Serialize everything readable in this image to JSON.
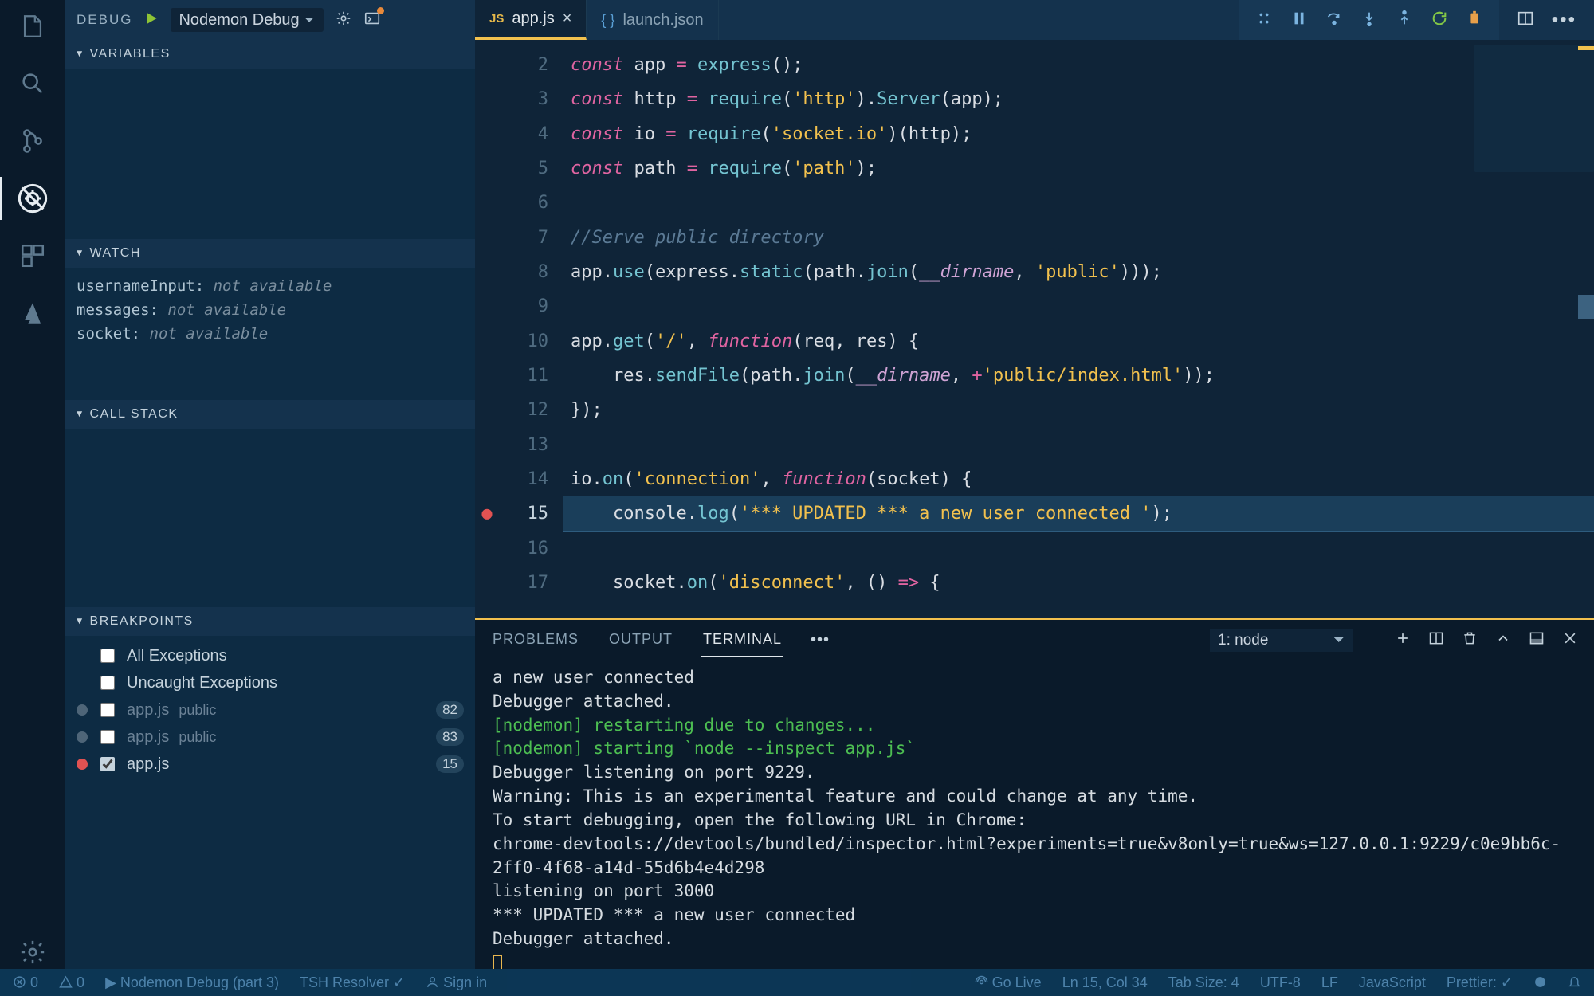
{
  "debug_toolbar": {
    "label": "DEBUG",
    "config": "Nodemon Debug"
  },
  "sections": {
    "variables": "VARIABLES",
    "watch": "WATCH",
    "call_stack": "CALL STACK",
    "breakpoints": "BREAKPOINTS"
  },
  "watch": [
    {
      "name": "usernameInput:",
      "state": "not available"
    },
    {
      "name": "messages:",
      "state": "not available"
    },
    {
      "name": "socket:",
      "state": "not available"
    }
  ],
  "breakpoints": {
    "all": "All Exceptions",
    "uncaught": "Uncaught Exceptions",
    "items": [
      {
        "file": "app.js",
        "path": "public",
        "line": "82",
        "active": false
      },
      {
        "file": "app.js",
        "path": "public",
        "line": "83",
        "active": false
      },
      {
        "file": "app.js",
        "path": "",
        "line": "15",
        "active": true
      }
    ]
  },
  "tabs": [
    {
      "label": "app.js",
      "type": "js",
      "active": true,
      "dirty": false
    },
    {
      "label": "launch.json",
      "type": "json",
      "active": false
    }
  ],
  "code": {
    "start": 2,
    "bp_line": 15,
    "hl_line": 15,
    "lines": [
      "<span class='kw'>const</span> <span class='vn'>app</span> <span class='op'>=</span> <span class='fnc'>express</span><span class='pn'>();</span>",
      "<span class='kw'>const</span> <span class='vn'>http</span> <span class='op'>=</span> <span class='fnc'>require</span><span class='pn'>(</span><span class='str'>'http'</span><span class='pn'>).</span><span class='fnc'>Server</span><span class='pn'>(</span><span class='vn'>app</span><span class='pn'>);</span>",
      "<span class='kw'>const</span> <span class='vn'>io</span> <span class='op'>=</span> <span class='fnc'>require</span><span class='pn'>(</span><span class='str'>'socket.io'</span><span class='pn'>)(</span><span class='vn'>http</span><span class='pn'>);</span>",
      "<span class='kw'>const</span> <span class='vn'>path</span> <span class='op'>=</span> <span class='fnc'>require</span><span class='pn'>(</span><span class='str'>'path'</span><span class='pn'>);</span>",
      "",
      "<span class='cm'>//Serve public directory</span>",
      "<span class='vn'>app</span><span class='pn'>.</span><span class='fnc'>use</span><span class='pn'>(</span><span class='vn'>express</span><span class='pn'>.</span><span class='fnc'>static</span><span class='pn'>(</span><span class='vn'>path</span><span class='pn'>.</span><span class='fnc'>join</span><span class='pn'>(</span><span class='dir'>__dirname</span><span class='pn'>, </span><span class='str'>'public'</span><span class='pn'>)));</span>",
      "",
      "<span class='vn'>app</span><span class='pn'>.</span><span class='fnc'>get</span><span class='pn'>(</span><span class='str'>'/'</span><span class='pn'>, </span><span class='kw2'>function</span><span class='pn'>(</span><span class='vn'>req</span><span class='pn'>, </span><span class='vn'>res</span><span class='pn'>) {</span>",
      "    <span class='vn'>res</span><span class='pn'>.</span><span class='fnc'>sendFile</span><span class='pn'>(</span><span class='vn'>path</span><span class='pn'>.</span><span class='fnc'>join</span><span class='pn'>(</span><span class='dir'>__dirname</span><span class='pn'>, </span><span class='op'>+</span><span class='str'>'public/index.html'</span><span class='pn'>));</span>",
      "<span class='pn'>});</span>",
      "",
      "<span class='vn'>io</span><span class='pn'>.</span><span class='fnc'>on</span><span class='pn'>(</span><span class='str'>'connection'</span><span class='pn'>, </span><span class='kw2'>function</span><span class='pn'>(</span><span class='vn'>socket</span><span class='pn'>) {</span>",
      "    <span class='vn'>console</span><span class='pn'>.</span><span class='fnc'>log</span><span class='pn'>(</span><span class='str'>'*** UPDATED *** a new user connected '</span><span class='pn'>);</span>",
      "",
      "    <span class='vn'>socket</span><span class='pn'>.</span><span class='fnc'>on</span><span class='pn'>(</span><span class='str'>'disconnect'</span><span class='pn'>, () </span><span class='kw2'>=&gt;</span><span class='pn'> {</span>"
    ]
  },
  "panel": {
    "tabs": [
      "PROBLEMS",
      "OUTPUT",
      "TERMINAL"
    ],
    "active": "TERMINAL",
    "selector": "1: node",
    "lines": [
      "a new user connected",
      "Debugger attached.",
      "<span class='g'>[nodemon] restarting due to changes...</span>",
      "<span class='g'>[nodemon] starting `node --inspect app.js`</span>",
      "Debugger listening on port 9229.",
      "Warning: This is an experimental feature and could change at any time.",
      "To start debugging, open the following URL in Chrome:",
      "    chrome-devtools://devtools/bundled/inspector.html?experiments=true&v8only=true&ws=127.0.0.1:9229/c0e9bb6c-2ff0-4f68-a14d-55d6b4e4d298",
      "listening on port 3000",
      "*** UPDATED *** a new user connected",
      "Debugger attached."
    ]
  },
  "status": {
    "errors": "0",
    "warnings": "0",
    "debug_name": "Nodemon Debug (part 3)",
    "resolver": "TSH Resolver ✓",
    "signin": "Sign in",
    "golive": "Go Live",
    "pos": "Ln 15, Col 34",
    "tabsize": "Tab Size: 4",
    "enc": "UTF-8",
    "eol": "LF",
    "lang": "JavaScript",
    "prettier": "Prettier: ✓"
  }
}
